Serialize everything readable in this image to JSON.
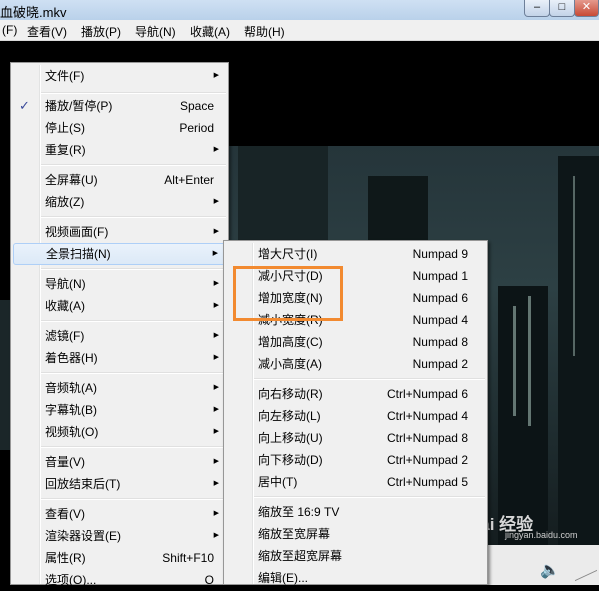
{
  "window": {
    "title": "血破晓.mkv",
    "minimize_icon": "minimize-icon",
    "maximize_icon": "maximize-icon",
    "close_icon": "close-icon",
    "min_glyph": "–",
    "max_glyph": "□",
    "close_glyph": "✕"
  },
  "menubar": {
    "items": [
      "(F)",
      "查看(V)",
      "播放(P)",
      "导航(N)",
      "收藏(A)",
      "帮助(H)"
    ]
  },
  "main_menu": {
    "items": [
      {
        "label": "文件(F)",
        "shortcut": "",
        "submenu": true
      },
      {
        "label": "播放/暂停(P)",
        "shortcut": "Space",
        "checked": true
      },
      {
        "label": "停止(S)",
        "shortcut": "Period"
      },
      {
        "label": "重复(R)",
        "shortcut": "",
        "submenu": true
      },
      {
        "label": "全屏幕(U)",
        "shortcut": "Alt+Enter"
      },
      {
        "label": "缩放(Z)",
        "shortcut": "",
        "submenu": true
      },
      {
        "label": "视频画面(F)",
        "shortcut": "",
        "submenu": true
      },
      {
        "label": "全景扫描(N)",
        "shortcut": "",
        "submenu": true,
        "highlighted": true
      },
      {
        "label": "导航(N)",
        "shortcut": "",
        "submenu": true
      },
      {
        "label": "收藏(A)",
        "shortcut": "",
        "submenu": true
      },
      {
        "label": "滤镜(F)",
        "shortcut": "",
        "submenu": true
      },
      {
        "label": "着色器(H)",
        "shortcut": "",
        "submenu": true
      },
      {
        "label": "音频轨(A)",
        "shortcut": "",
        "submenu": true
      },
      {
        "label": "字幕轨(B)",
        "shortcut": "",
        "submenu": true
      },
      {
        "label": "视频轨(O)",
        "shortcut": "",
        "submenu": true
      },
      {
        "label": "音量(V)",
        "shortcut": "",
        "submenu": true
      },
      {
        "label": "回放结束后(T)",
        "shortcut": "",
        "submenu": true
      },
      {
        "label": "查看(V)",
        "shortcut": "",
        "submenu": true
      },
      {
        "label": "渲染器设置(E)",
        "shortcut": "",
        "submenu": true
      },
      {
        "label": "属性(R)",
        "shortcut": "Shift+F10"
      },
      {
        "label": "选项(O)...",
        "shortcut": "O"
      }
    ],
    "check_glyph": "✓",
    "arrow_glyph": "▶"
  },
  "panscan_menu": {
    "items": [
      {
        "label": "增大尺寸(I)",
        "shortcut": "Numpad 9"
      },
      {
        "label": "减小尺寸(D)",
        "shortcut": "Numpad 1"
      },
      {
        "label": "增加宽度(N)",
        "shortcut": "Numpad 6"
      },
      {
        "label": "减小宽度(R)",
        "shortcut": "Numpad 4"
      },
      {
        "label": "增加高度(C)",
        "shortcut": "Numpad 8"
      },
      {
        "label": "减小高度(A)",
        "shortcut": "Numpad 2"
      },
      {
        "label": "向右移动(R)",
        "shortcut": "Ctrl+Numpad 6"
      },
      {
        "label": "向左移动(L)",
        "shortcut": "Ctrl+Numpad 4"
      },
      {
        "label": "向上移动(U)",
        "shortcut": "Ctrl+Numpad 8"
      },
      {
        "label": "向下移动(D)",
        "shortcut": "Ctrl+Numpad 2"
      },
      {
        "label": "居中(T)",
        "shortcut": "Ctrl+Numpad 5"
      },
      {
        "label": "缩放至 16:9 TV",
        "shortcut": ""
      },
      {
        "label": "缩放至宽屏幕",
        "shortcut": ""
      },
      {
        "label": "缩放至超宽屏幕",
        "shortcut": ""
      },
      {
        "label": "编辑(E)...",
        "shortcut": ""
      }
    ]
  },
  "player": {
    "speaker_icon": "speaker-icon",
    "speaker_glyph": "🔈",
    "watermark": "Bai 经验",
    "watermark_sub": "jingyan.baidu.com"
  },
  "colors": {
    "annotation_box": "#f28a30",
    "highlight_bg": "#dce9f7"
  }
}
